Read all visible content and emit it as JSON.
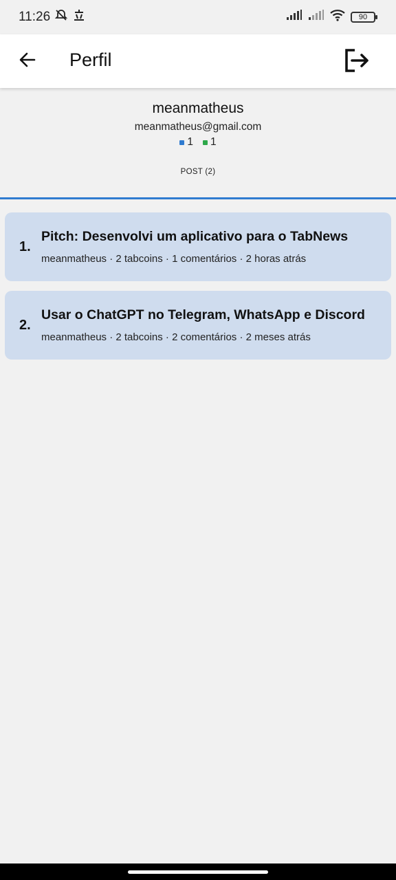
{
  "status_bar": {
    "time": "11:26",
    "battery": "90",
    "icons": [
      "alarm-off-icon",
      "notification-icon",
      "signal-icon",
      "signal-weak-icon",
      "wifi-icon",
      "battery-icon"
    ]
  },
  "app_bar": {
    "title": "Perfil",
    "back_icon": "arrow-left-icon",
    "logout_icon": "logout-icon"
  },
  "profile": {
    "username": "meanmatheus",
    "email": "meanmatheus@gmail.com",
    "stats": [
      {
        "value": "1",
        "color": "#2f7bd0"
      },
      {
        "value": "1",
        "color": "#2ea84a"
      }
    ],
    "tab_label": "POST (2)"
  },
  "posts": [
    {
      "number": "1.",
      "title": "Pitch: Desenvolvi um aplicativo para o TabNews",
      "meta": "meanmatheus · 2 tabcoins · 1 comentários · 2 horas atrás"
    },
    {
      "number": "2.",
      "title": "Usar o ChatGPT no Telegram, WhatsApp e Discord",
      "meta": "meanmatheus · 2 tabcoins · 2 comentários · 2 meses atrás"
    }
  ],
  "colors": {
    "accent": "#2f7bd0",
    "card_bg": "#cfdcee",
    "page_bg": "#f1f1f1"
  }
}
